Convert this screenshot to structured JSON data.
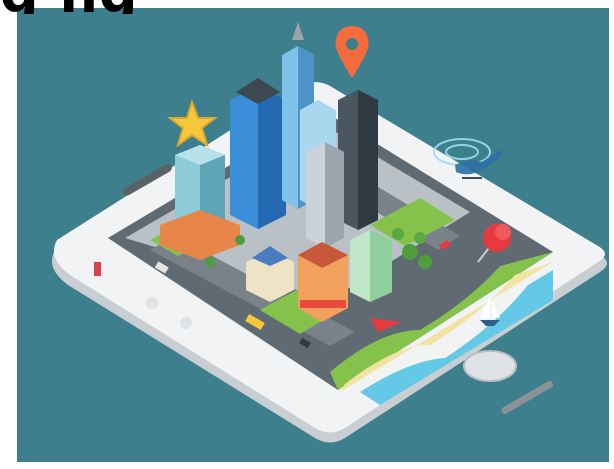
{
  "image": {
    "kind": "isometric smartphone city illustration",
    "background_color": "#3d7f8c",
    "phone_color": "#f1f3f4",
    "screen_color": "#5f6a72",
    "water_color": "#63c9e6",
    "sand_color": "#f2e3a3",
    "grass_color": "#84c24b",
    "pin_color": "#f46b3d",
    "pushpin_color": "#e63a3f",
    "star_color": "#f5c93b",
    "helicopter_color": "#9fdcf0",
    "title_fragment": "g     ng"
  },
  "icons": [
    "location-pin-icon",
    "star-icon",
    "pushpin-icon",
    "helicopter-icon",
    "sailboat-icon",
    "paper-plane-icon"
  ]
}
